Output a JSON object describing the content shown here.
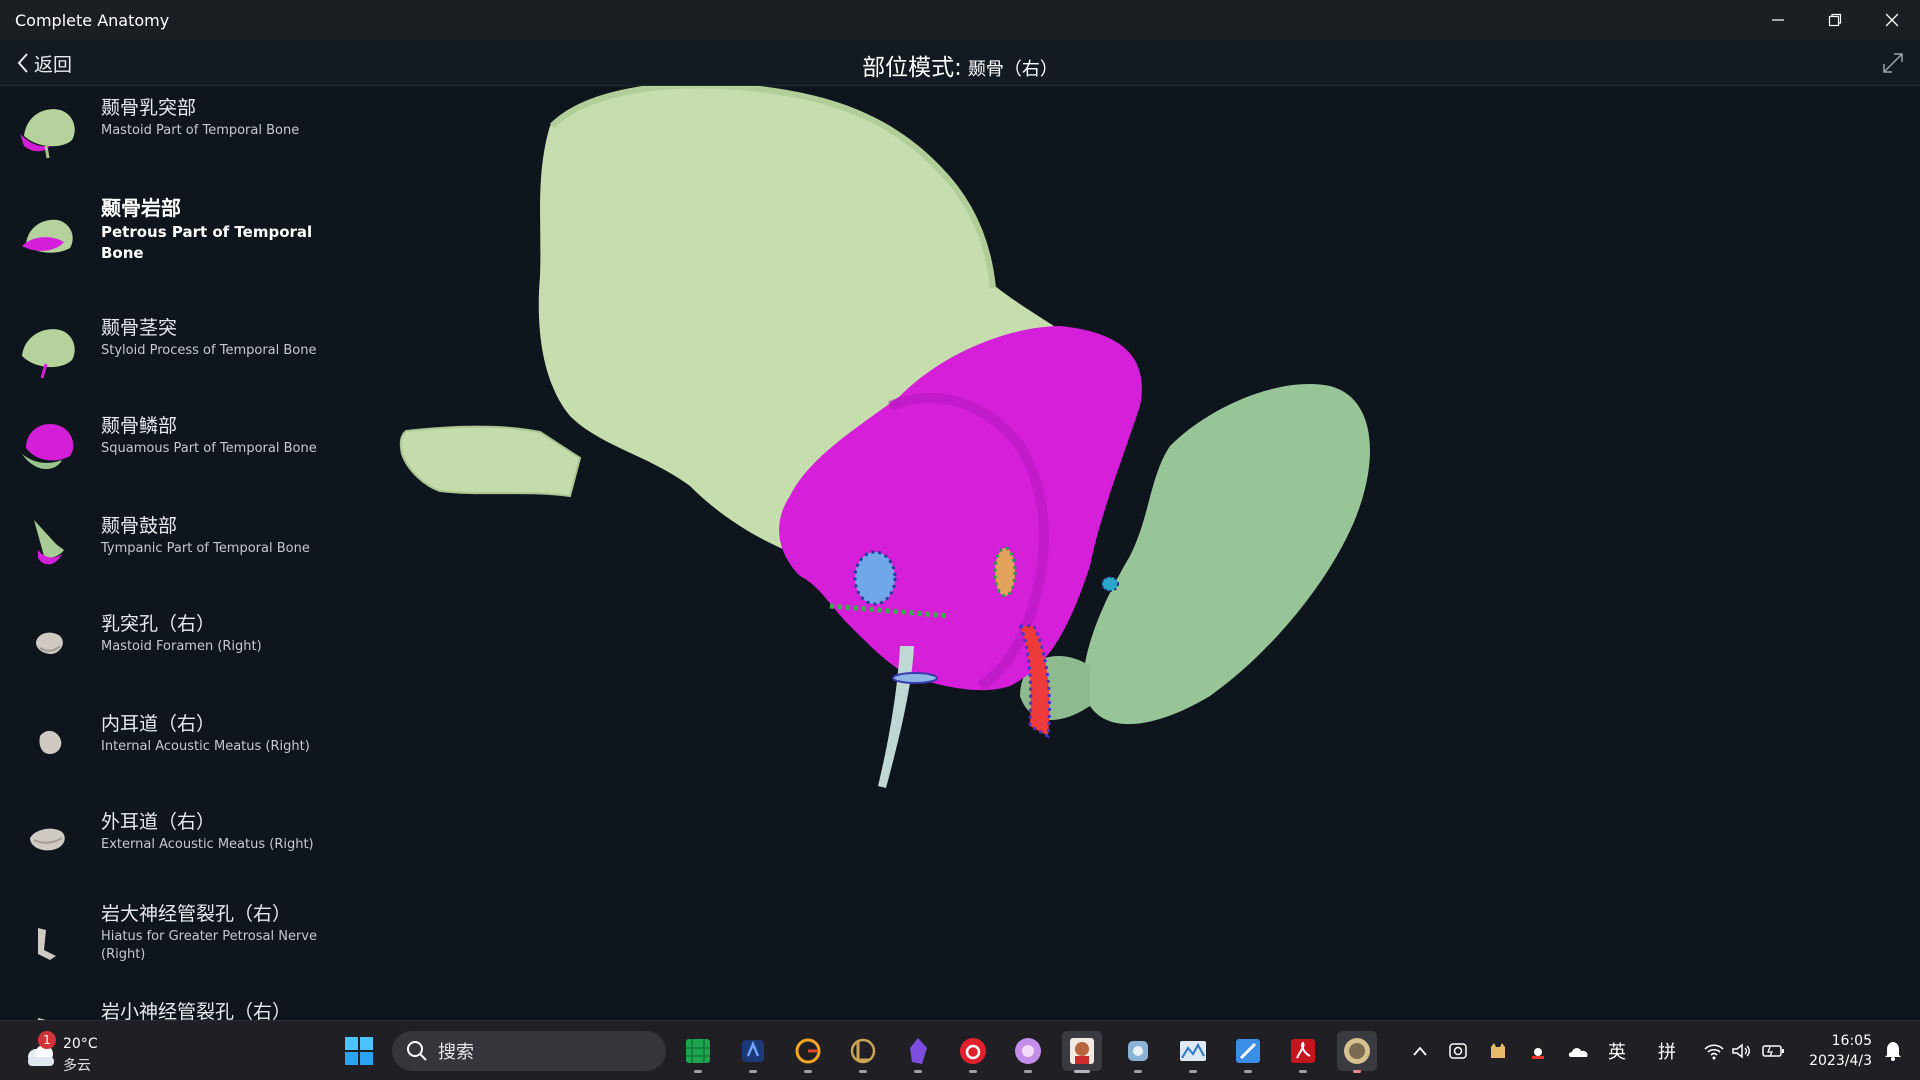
{
  "window": {
    "title": "Complete Anatomy"
  },
  "header": {
    "back_label": "返回",
    "mode_label": "部位模式:",
    "subject": "颞骨（右）"
  },
  "structures": [
    {
      "cn": "颞骨乳突部",
      "en": "Mastoid Part of Temporal Bone",
      "active": false
    },
    {
      "cn": "颞骨岩部",
      "en": "Petrous Part of Temporal Bone",
      "active": true
    },
    {
      "cn": "颞骨茎突",
      "en": "Styloid Process of Temporal Bone",
      "active": false
    },
    {
      "cn": "颞骨鳞部",
      "en": "Squamous Part of Temporal Bone",
      "active": false
    },
    {
      "cn": "颞骨鼓部",
      "en": "Tympanic Part of Temporal Bone",
      "active": false
    },
    {
      "cn": "乳突孔（右）",
      "en": "Mastoid Foramen (Right)",
      "active": false
    },
    {
      "cn": "内耳道（右）",
      "en": "Internal Acoustic Meatus (Right)",
      "active": false
    },
    {
      "cn": "外耳道（右）",
      "en": "External Acoustic Meatus (Right)",
      "active": false
    },
    {
      "cn": "岩大神经管裂孔（右）",
      "en": "Hiatus for Greater Petrosal Nerve (Right)",
      "active": false
    },
    {
      "cn": "岩小神经管裂孔（右）",
      "en": "",
      "active": false
    }
  ],
  "colors": {
    "bone_green": "#c3dbaa",
    "bone_green_dark": "#98c499",
    "highlight_magenta": "#d41fd8",
    "background": "#0f151c"
  },
  "taskbar": {
    "weather": {
      "temp": "20°C",
      "desc": "多云",
      "badge": "1"
    },
    "search_label": "搜索",
    "apps": [
      "sheets-icon",
      "ink-icon",
      "grammarly-icon",
      "league-icon",
      "obsidian-icon",
      "netease-music-icon",
      "fairy-icon",
      "anatomy-avatar-icon",
      "pet-icon",
      "chart-app-icon",
      "blue-app-icon",
      "pdf-icon",
      "complete-anatomy-icon"
    ],
    "tray": {
      "lang": "英",
      "ime": "拼"
    },
    "clock": {
      "time": "16:05",
      "date": "2023/4/3"
    }
  }
}
